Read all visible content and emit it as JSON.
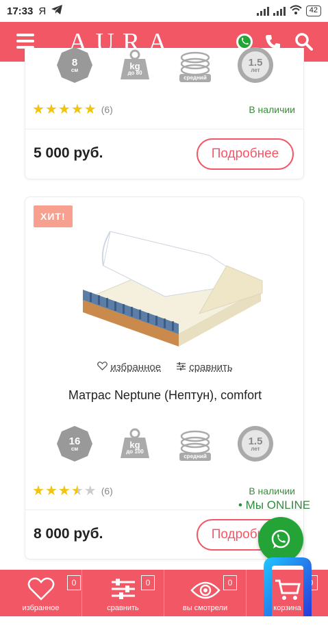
{
  "status_bar": {
    "time": "17:33",
    "carrier_glyph": "Я",
    "battery": "42"
  },
  "header": {
    "logo": "AURA",
    "icons": [
      "menu-icon",
      "whatsapp-icon",
      "phone-icon",
      "search-icon"
    ]
  },
  "product1": {
    "badges": [
      {
        "value": "8",
        "unit": "см"
      },
      {
        "value": "kg",
        "unit": "до 80"
      },
      {
        "value": "",
        "unit": "средний"
      },
      {
        "value": "1.5",
        "unit": "лет"
      }
    ],
    "rating": 5,
    "reviews": "(6)",
    "availability": "В наличии",
    "price": "5 000 руб.",
    "more_label": "Подробнее"
  },
  "product2": {
    "hit_label": "ХИТ!",
    "favorite_label": "избранное",
    "compare_label": "сравнить",
    "title": "Матрас Neptune (Нептун), comfort",
    "badges": [
      {
        "value": "16",
        "unit": "см"
      },
      {
        "value": "kg",
        "unit": "до 100"
      },
      {
        "value": "",
        "unit": "средний"
      },
      {
        "value": "1.5",
        "unit": "лет"
      }
    ],
    "rating": 3.5,
    "reviews": "(6)",
    "availability": "В наличии",
    "price": "8 000 руб.",
    "more_label": "Подробнее"
  },
  "online_label": "• Мы ONLINE",
  "bottom_nav": [
    {
      "label": "избранное",
      "count": "0",
      "icon": "heart-icon"
    },
    {
      "label": "сравнить",
      "count": "0",
      "icon": "sliders-icon"
    },
    {
      "label": "вы смотрели",
      "count": "0",
      "icon": "eye-icon"
    },
    {
      "label": "корзина",
      "count": "0",
      "icon": "cart-icon"
    }
  ],
  "colors": {
    "brand": "#f25766",
    "in_stock": "#3a8a3a",
    "whatsapp": "#24a436",
    "star": "#f1c40f",
    "hit_badge": "#f7a08f"
  }
}
